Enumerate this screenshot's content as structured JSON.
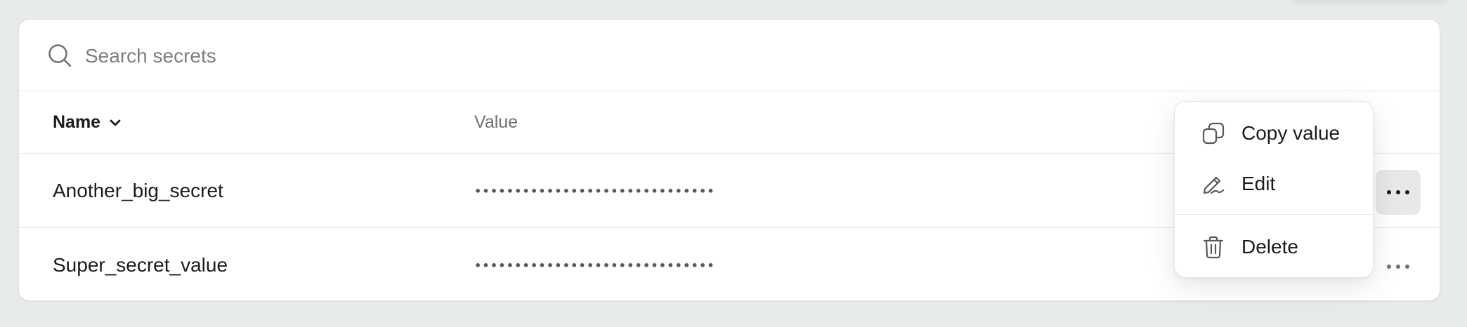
{
  "search": {
    "placeholder": "Search secrets",
    "icon": "search-icon"
  },
  "table": {
    "columns": {
      "name": "Name",
      "value": "Value"
    },
    "rows": [
      {
        "name": "Another_big_secret",
        "value": "••••••••••••••••••••••••••••••"
      },
      {
        "name": "Super_secret_value",
        "value": "••••••••••••••••••••••••••••••"
      }
    ]
  },
  "menu": {
    "copy_label": "Copy value",
    "edit_label": "Edit",
    "delete_label": "Delete"
  },
  "colors": {
    "page_bg": "#e8ebeb",
    "card_bg": "#ffffff",
    "text": "#1c1c1f",
    "muted_text": "#6e7176"
  }
}
